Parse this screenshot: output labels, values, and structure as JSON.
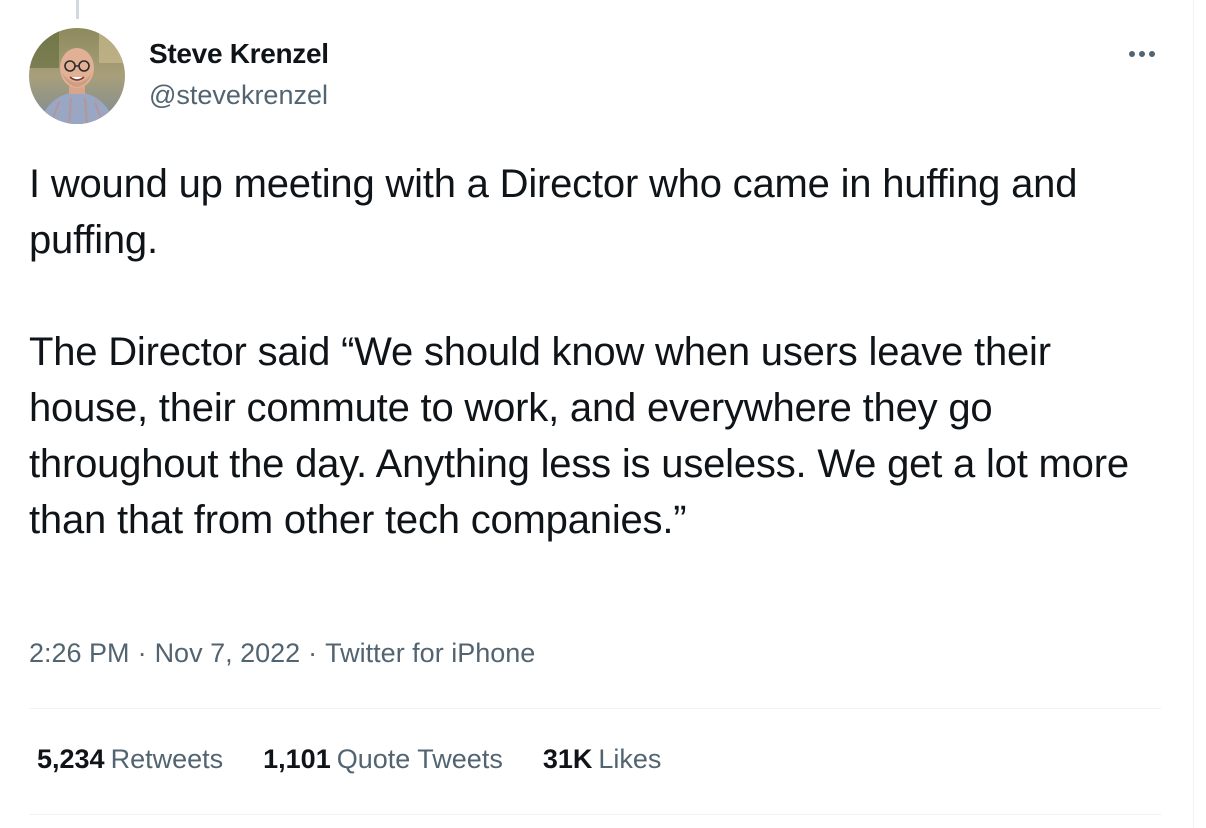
{
  "author": {
    "display_name": "Steve Krenzel",
    "handle": "@stevekrenzel",
    "avatar": "profile-photo"
  },
  "tweet": {
    "paragraphs": [
      "I wound up meeting with a Director who came in huffing and puffing.",
      "The Director said “We should know when users leave their house, their commute to work, and everywhere they go throughout the day. Anything less is useless. We get a lot more than that from other tech companies.”"
    ]
  },
  "meta": {
    "time": "2:26 PM",
    "separator": "·",
    "date": "Nov 7, 2022",
    "source": "Twitter for iPhone"
  },
  "stats": {
    "retweets": {
      "count": "5,234",
      "label": "Retweets"
    },
    "quotes": {
      "count": "1,101",
      "label": "Quote Tweets"
    },
    "likes": {
      "count": "31K",
      "label": "Likes"
    }
  },
  "icons": {
    "more": "more-horizontal-icon"
  },
  "colors": {
    "text_primary": "#0f1419",
    "text_secondary": "#536471",
    "divider": "#eff3f4"
  }
}
